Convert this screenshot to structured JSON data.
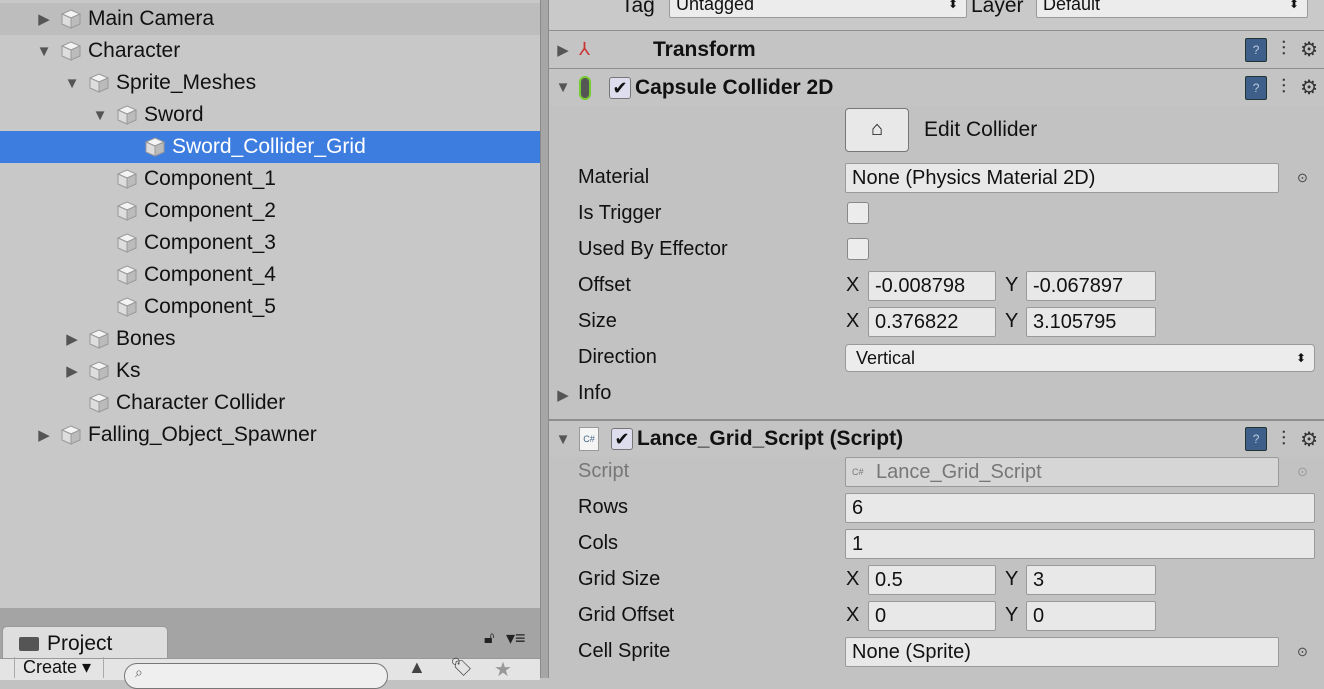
{
  "hierarchy": {
    "items": [
      {
        "label": "Main Camera",
        "depth": 0,
        "arrow": "collapsed"
      },
      {
        "label": "Character",
        "depth": 0,
        "arrow": "expanded"
      },
      {
        "label": "Sprite_Meshes",
        "depth": 1,
        "arrow": "expanded"
      },
      {
        "label": "Sword",
        "depth": 2,
        "arrow": "expanded"
      },
      {
        "label": "Sword_Collider_Grid",
        "depth": 3,
        "arrow": "none",
        "selected": true
      },
      {
        "label": "Component_1",
        "depth": 2,
        "arrow": "none"
      },
      {
        "label": "Component_2",
        "depth": 2,
        "arrow": "none"
      },
      {
        "label": "Component_3",
        "depth": 2,
        "arrow": "none"
      },
      {
        "label": "Component_4",
        "depth": 2,
        "arrow": "none"
      },
      {
        "label": "Component_5",
        "depth": 2,
        "arrow": "none"
      },
      {
        "label": "Bones",
        "depth": 1,
        "arrow": "collapsed"
      },
      {
        "label": "Ks",
        "depth": 1,
        "arrow": "collapsed"
      },
      {
        "label": "Character Collider",
        "depth": 1,
        "arrow": "none"
      },
      {
        "label": "Falling_Object_Spawner",
        "depth": 0,
        "arrow": "collapsed"
      }
    ],
    "selected_color": "#3e7de0"
  },
  "project": {
    "tab": "Project",
    "create": "Create ▾",
    "search_placeholder": ""
  },
  "inspector": {
    "tag_label": "Tag",
    "tag_value": "Untagged",
    "layer_label": "Layer",
    "layer_value": "Default",
    "transform": {
      "title": "Transform"
    },
    "collider": {
      "title": "Capsule Collider 2D",
      "enabled": true,
      "edit_collider": "Edit Collider",
      "material_label": "Material",
      "material_value": "None (Physics Material 2D)",
      "trigger_label": "Is Trigger",
      "is_trigger": false,
      "effector_label": "Used By Effector",
      "used_by_effector": false,
      "offset_label": "Offset",
      "offset_x": "-0.008798",
      "offset_y": "-0.067897",
      "size_label": "Size",
      "size_x": "0.376822",
      "size_y": "3.105795",
      "direction_label": "Direction",
      "direction_value": "Vertical",
      "info_label": "Info"
    },
    "script": {
      "title": "Lance_Grid_Script (Script)",
      "enabled": true,
      "script_label": "Script",
      "script_value": "Lance_Grid_Script",
      "rows_label": "Rows",
      "rows": "6",
      "cols_label": "Cols",
      "cols": "1",
      "grid_size_label": "Grid Size",
      "grid_size_x": "0.5",
      "grid_size_y": "3",
      "grid_offset_label": "Grid Offset",
      "grid_offset_x": "0",
      "grid_offset_y": "0",
      "cell_sprite_label": "Cell Sprite",
      "cell_sprite_value": "None (Sprite)"
    },
    "x": "X",
    "y": "Y"
  }
}
